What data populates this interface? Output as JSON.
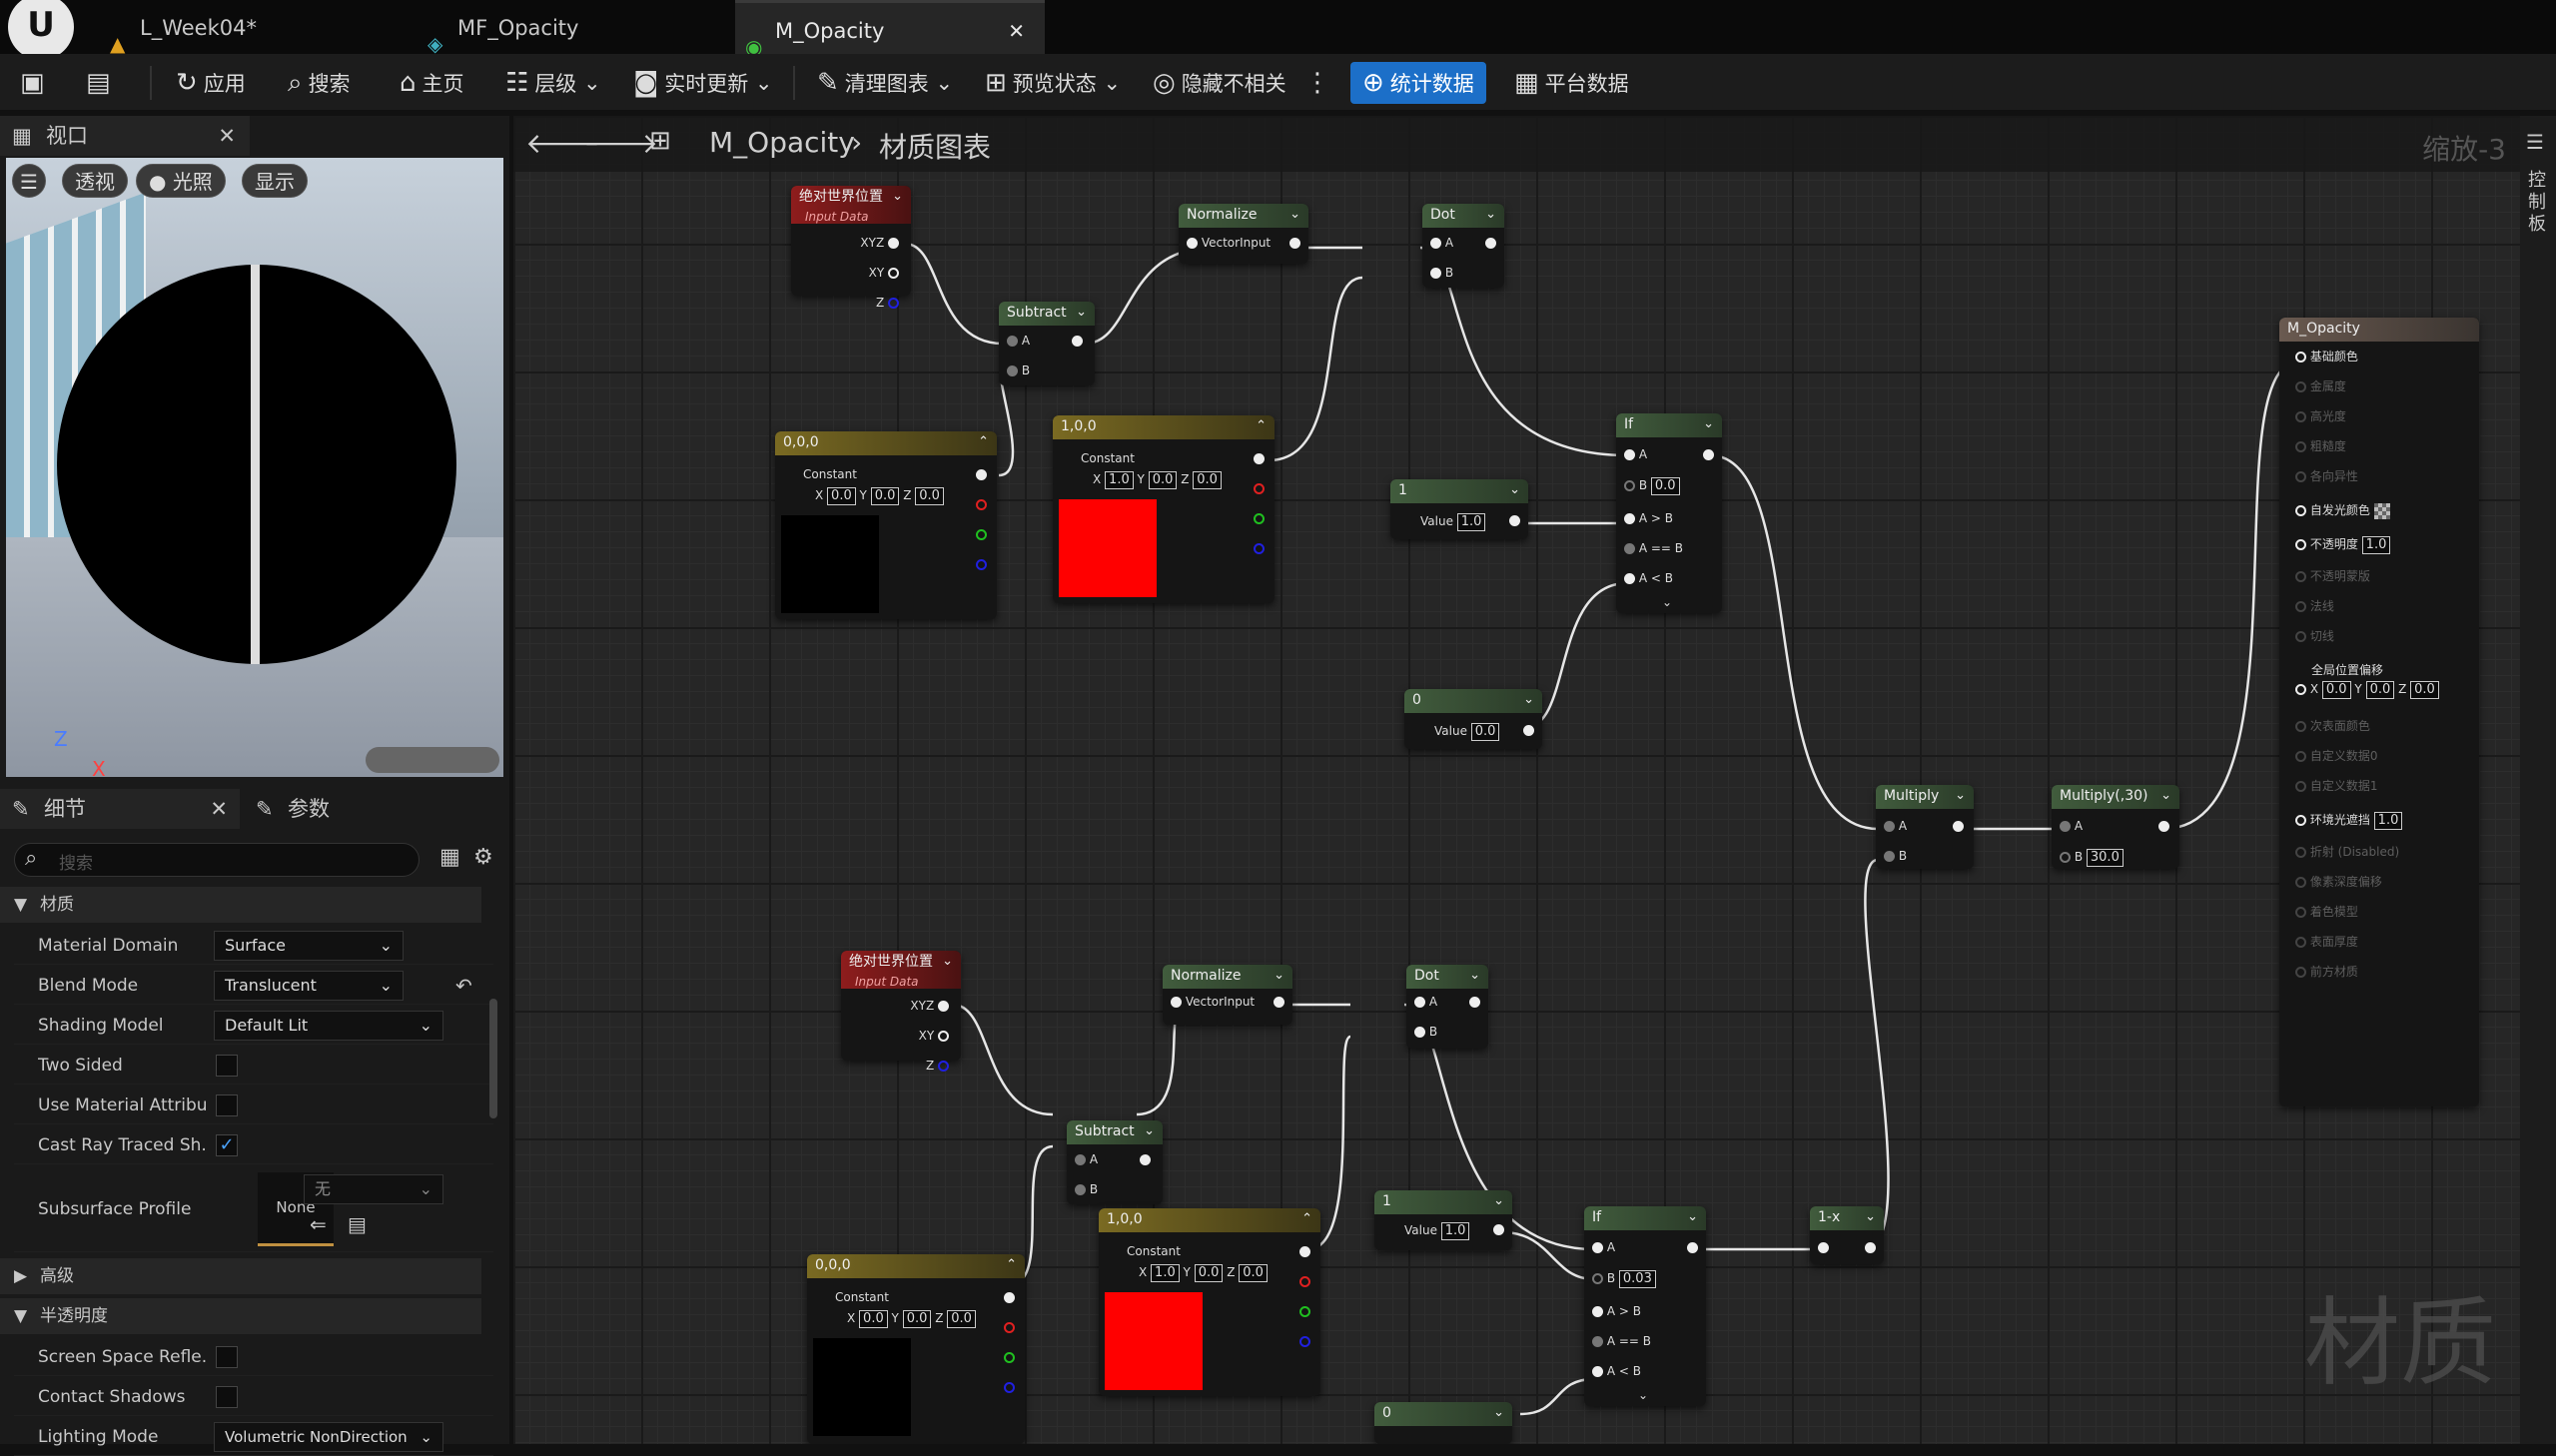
{
  "doc_tabs": [
    {
      "label": "L_Week04*",
      "icon": "level-icon"
    },
    {
      "label": "MF_Opacity",
      "icon": "function-icon"
    },
    {
      "label": "M_Opacity",
      "icon": "material-icon"
    }
  ],
  "toolbar": {
    "apply": "应用",
    "search": "搜索",
    "home": "主页",
    "hierarchy": "层级",
    "live_update": "实时更新",
    "clean_graph": "清理图表",
    "preview_state": "预览状态",
    "hide_unrelated": "隐藏不相关",
    "stats": "统计数据",
    "platform_stats": "平台数据"
  },
  "viewport": {
    "tab": "视口",
    "perspective": "透视",
    "lit": "光照",
    "show": "显示"
  },
  "details": {
    "tab1": "细节",
    "tab2": "参数",
    "search_placeholder": "搜索",
    "section_material": "材质",
    "rows": [
      {
        "label": "Material Domain",
        "value": "Surface"
      },
      {
        "label": "Blend Mode",
        "value": "Translucent"
      },
      {
        "label": "Shading Model",
        "value": "Default Lit"
      },
      {
        "label": "Two Sided"
      },
      {
        "label": "Use Material Attribu..."
      },
      {
        "label": "Cast Ray Traced Sh..."
      }
    ],
    "subsurface_label": "Subsurface Profile",
    "subsurface_none": "None",
    "subsurface_dd": "无",
    "section_advanced": "高级",
    "section_translucency": "半透明度",
    "trans_rows": [
      {
        "label": "Screen Space Refle..."
      },
      {
        "label": "Contact Shadows"
      },
      {
        "label": "Lighting Mode",
        "value": "Volumetric NonDirection"
      }
    ]
  },
  "graph": {
    "title": "M_Opacity",
    "subtitle": "材质图表",
    "zoom": "缩放-3",
    "side": "控制板",
    "watermark": "材质",
    "n_awp1": {
      "title": "绝对世界位置",
      "sub": "Input Data",
      "xyz": "XYZ",
      "xy": "XY",
      "z": "Z"
    },
    "n_awp2": {
      "title": "绝对世界位置",
      "sub": "Input Data",
      "xyz": "XYZ",
      "xy": "XY",
      "z": "Z"
    },
    "n_norm1": {
      "title": "Normalize",
      "pin": "VectorInput"
    },
    "n_norm2": {
      "title": "Normalize",
      "pin": "VectorInput"
    },
    "n_dot1": {
      "title": "Dot",
      "a": "A",
      "b": "B"
    },
    "n_dot2": {
      "title": "Dot",
      "a": "A",
      "b": "B"
    },
    "n_sub1": {
      "title": "Subtract",
      "a": "A",
      "b": "B"
    },
    "n_sub2": {
      "title": "Subtract",
      "a": "A",
      "b": "B"
    },
    "n_c000a": {
      "title": "0,0,0",
      "label": "Constant",
      "x": "0.0",
      "y": "0.0",
      "z": "0.0"
    },
    "n_c100a": {
      "title": "1,0,0",
      "label": "Constant",
      "x": "1.0",
      "y": "0.0",
      "z": "0.0"
    },
    "n_c000b": {
      "title": "0,0,0",
      "label": "Constant",
      "x": "0.0",
      "y": "0.0",
      "z": "0.0"
    },
    "n_c100b": {
      "title": "1,0,0",
      "label": "Constant",
      "x": "1.0",
      "y": "0.0",
      "z": "0.0"
    },
    "n_v1a": {
      "title": "1",
      "label": "Value",
      "value": "1.0"
    },
    "n_v0a": {
      "title": "0",
      "label": "Value",
      "value": "0.0"
    },
    "n_v1b": {
      "title": "1",
      "label": "Value",
      "value": "1.0"
    },
    "n_v0b": {
      "title": "0"
    },
    "n_if1": {
      "title": "If",
      "a": "A",
      "b": "B",
      "bval": "0.0",
      "agb": "A > B",
      "aeb": "A == B",
      "alb": "A < B"
    },
    "n_if2": {
      "title": "If",
      "a": "A",
      "b": "B",
      "bval": "0.03",
      "agb": "A > B",
      "aeb": "A == B",
      "alb": "A < B"
    },
    "n_mul": {
      "title": "Multiply",
      "a": "A",
      "b": "B"
    },
    "n_mul30": {
      "title": "Multiply(,30)",
      "a": "A",
      "b": "B",
      "bval": "30.0"
    },
    "n_omx": {
      "title": "1-x"
    },
    "n_out": {
      "title": "M_Opacity",
      "pins": [
        "基础颜色",
        "金属度",
        "高光度",
        "粗糙度",
        "各向异性",
        "自发光颜色",
        "不透明度",
        "不透明蒙版",
        "法线",
        "切线",
        "全局位置偏移",
        "次表面颜色",
        "自定义数据0",
        "自定义数据1",
        "环境光遮挡",
        "折射 (Disabled)",
        "像素深度偏移",
        "着色模型",
        "表面厚度",
        "前方材质"
      ],
      "opacity_val": "1.0",
      "ao_val": "1.0",
      "wpo_x": "0.0",
      "wpo_y": "0.0",
      "wpo_z": "0.0",
      "x": "X",
      "y": "Y",
      "z": "Z"
    }
  }
}
